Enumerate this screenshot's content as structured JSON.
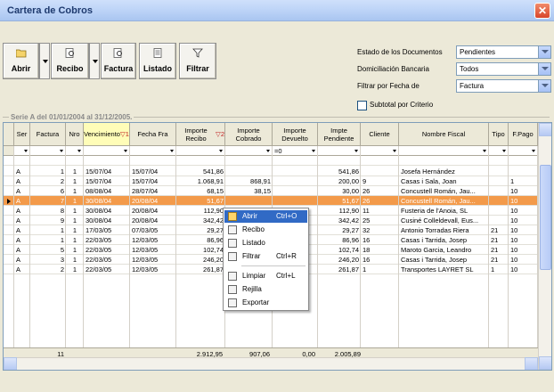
{
  "window": {
    "title": "Cartera de Cobros"
  },
  "toolbar": {
    "abrir": "Abrir",
    "recibo": "Recibo",
    "factura": "Factura",
    "listado": "Listado",
    "filtrar": "Filtrar"
  },
  "filters": {
    "estado_label": "Estado de los Documentos",
    "estado_value": "Pendientes",
    "domiciliacion_label": "Domiciliación Bancaria",
    "domiciliacion_value": "Todos",
    "fecha_label": "Filtrar por Fecha de",
    "fecha_value": "Factura",
    "subtotal_label": "Subtotal por Criterio"
  },
  "serie_label": "Serie A del 01/01/2004 al 31/12/2005.",
  "grid": {
    "headers": [
      "Ser",
      "Factura",
      "Nro",
      "Vencimiento",
      "Fecha Fra",
      "Importe Recibo",
      "Importe Cobrado",
      "Importe Devuelto",
      "Impte Pendiente",
      "Cliente",
      "Nombre Fiscal",
      "Tipo",
      "F.Pago"
    ],
    "sort_vencimiento": "▽1",
    "sort_importe": "▽2",
    "filter_devuelto": "=0",
    "rows": [
      [
        "",
        "",
        "",
        "",
        "",
        "",
        "",
        "",
        "",
        "",
        "",
        "",
        ""
      ],
      [
        "A",
        "1",
        "1",
        "15/07/04",
        "15/07/04",
        "541,86",
        "",
        "",
        "541,86",
        "",
        "Josefa Hernández",
        "",
        ""
      ],
      [
        "A",
        "2",
        "1",
        "15/07/04",
        "15/07/04",
        "1.068,91",
        "868,91",
        "",
        "200,00",
        "9",
        "Casas i Sala, Joan",
        "",
        "1"
      ],
      [
        "A",
        "6",
        "1",
        "08/08/04",
        "28/07/04",
        "68,15",
        "38,15",
        "",
        "30,00",
        "26",
        "Concustell Román, Jau...",
        "",
        "10"
      ],
      [
        "A",
        "7",
        "1",
        "30/08/04",
        "20/08/04",
        "51,67",
        "",
        "",
        "51,67",
        "26",
        "Concustell Román, Jau...",
        "",
        "10"
      ],
      [
        "A",
        "8",
        "1",
        "30/08/04",
        "20/08/04",
        "112,90",
        "",
        "",
        "112,90",
        "11",
        "Fusteria de l'Anoia, SL",
        "",
        "10"
      ],
      [
        "A",
        "9",
        "1",
        "30/08/04",
        "20/08/04",
        "342,42",
        "",
        "",
        "342,42",
        "25",
        "Cusiné Colleldevall, Eus...",
        "",
        "10"
      ],
      [
        "A",
        "1",
        "1",
        "17/03/05",
        "07/03/05",
        "29,27",
        "",
        "",
        "29,27",
        "32",
        "Antonio Torradas Riera",
        "21",
        "10"
      ],
      [
        "A",
        "1",
        "1",
        "22/03/05",
        "12/03/05",
        "86,96",
        "",
        "",
        "86,96",
        "16",
        "Casas i Tarrida, Josep",
        "21",
        "10"
      ],
      [
        "A",
        "5",
        "1",
        "22/03/05",
        "12/03/05",
        "102,74",
        "",
        "",
        "102,74",
        "18",
        "Maroto Garcia, Leandro",
        "21",
        "10"
      ],
      [
        "A",
        "3",
        "1",
        "22/03/05",
        "12/03/05",
        "246,20",
        "",
        "",
        "246,20",
        "16",
        "Casas i Tarrida, Josep",
        "21",
        "10"
      ],
      [
        "A",
        "2",
        "1",
        "22/03/05",
        "12/03/05",
        "261,87",
        "",
        "",
        "261,87",
        "1",
        "Transportes LAYRET SL",
        "1",
        "10"
      ]
    ],
    "totals": {
      "factura": "11",
      "recibo": "2.912,95",
      "cobrado": "907,06",
      "devuelto": "0,00",
      "pendiente": "2.005,89"
    }
  },
  "context_menu": {
    "items": [
      {
        "label": "Abrir",
        "shortcut": "Ctrl+O"
      },
      {
        "label": "Recibo",
        "shortcut": ""
      },
      {
        "label": "Listado",
        "shortcut": ""
      },
      {
        "label": "Filtrar",
        "shortcut": "Ctrl+R"
      },
      {
        "label": "Limpiar",
        "shortcut": "Ctrl+L"
      },
      {
        "label": "Rejilla",
        "shortcut": ""
      },
      {
        "label": "Exportar",
        "shortcut": ""
      }
    ]
  },
  "colors": {
    "selected_row": "#f39a4a",
    "menu_highlight": "#316ac5",
    "title_bar": "#b9d1f6"
  }
}
